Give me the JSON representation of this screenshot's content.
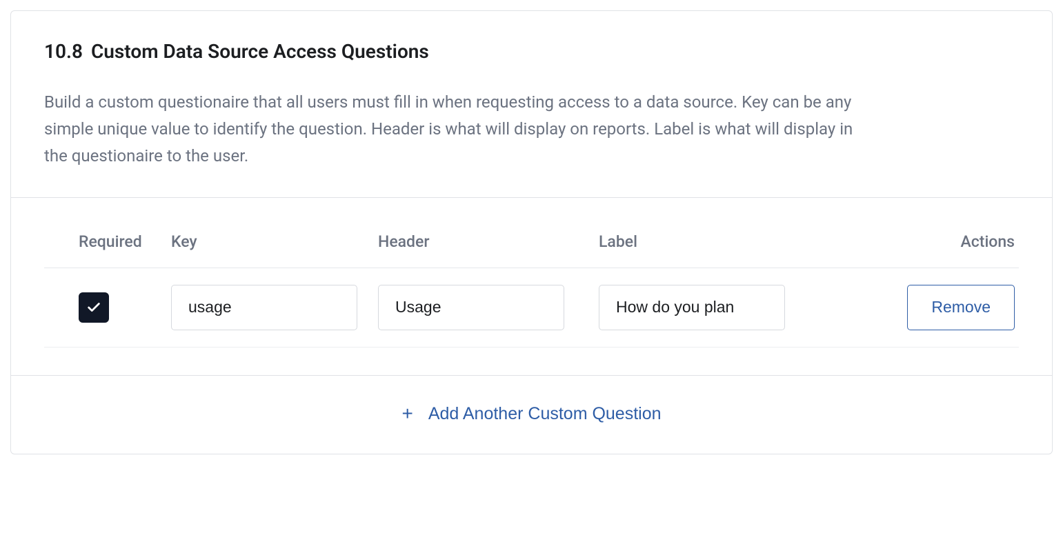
{
  "section": {
    "number": "10.8",
    "title": "Custom Data Source Access Questions",
    "description": "Build a custom questionaire that all users must fill in when requesting access to a data source. Key can be any simple unique value to identify the question. Header is what will display on reports. Label is what will display in the questionaire to the user."
  },
  "table": {
    "columns": {
      "required": "Required",
      "key": "Key",
      "header": "Header",
      "label": "Label",
      "actions": "Actions"
    },
    "rows": [
      {
        "required": true,
        "key": "usage",
        "header": "Usage",
        "label": "How do you plan"
      }
    ],
    "remove_label": "Remove"
  },
  "footer": {
    "add_label": "Add Another Custom Question"
  }
}
